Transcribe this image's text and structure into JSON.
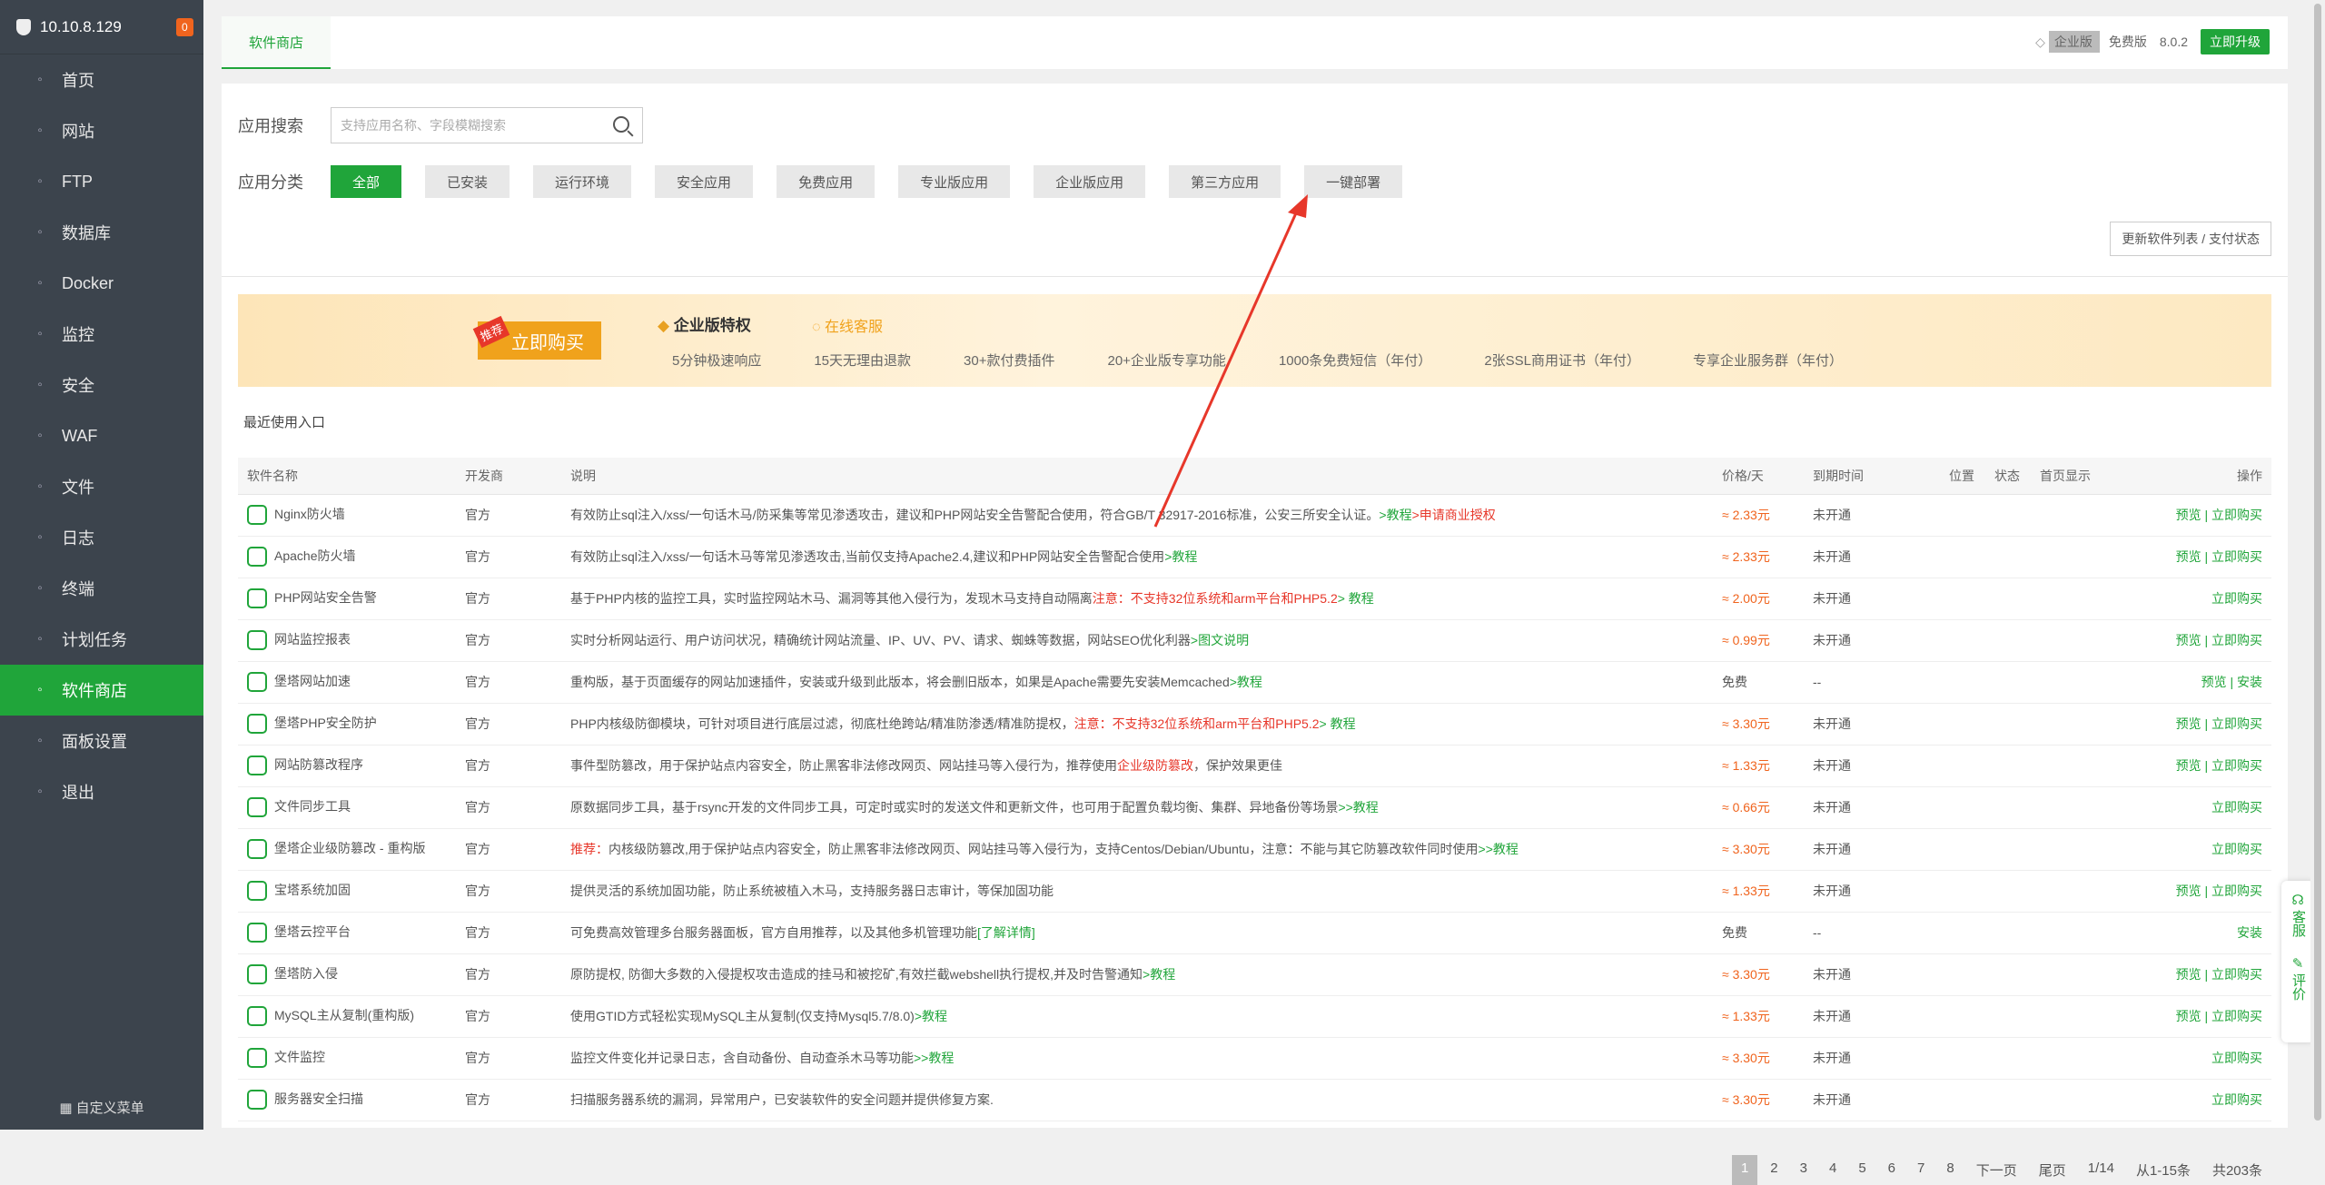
{
  "sidebar": {
    "ip": "10.10.8.129",
    "badge": "0",
    "items": [
      {
        "label": "首页",
        "icon": "home-icon"
      },
      {
        "label": "网站",
        "icon": "globe-icon"
      },
      {
        "label": "FTP",
        "icon": "ftp-icon"
      },
      {
        "label": "数据库",
        "icon": "database-icon"
      },
      {
        "label": "Docker",
        "icon": "docker-icon"
      },
      {
        "label": "监控",
        "icon": "monitor-icon"
      },
      {
        "label": "安全",
        "icon": "shield-icon"
      },
      {
        "label": "WAF",
        "icon": "waf-icon"
      },
      {
        "label": "文件",
        "icon": "folder-icon"
      },
      {
        "label": "日志",
        "icon": "log-icon"
      },
      {
        "label": "终端",
        "icon": "terminal-icon"
      },
      {
        "label": "计划任务",
        "icon": "clock-icon"
      },
      {
        "label": "软件商店",
        "icon": "store-icon"
      },
      {
        "label": "面板设置",
        "icon": "gear-icon"
      },
      {
        "label": "退出",
        "icon": "logout-icon"
      }
    ],
    "custom_menu": "自定义菜单"
  },
  "header": {
    "tab": "软件商店",
    "edition": "企业版",
    "free": "免费版",
    "version": "8.0.2",
    "upgrade": "立即升级"
  },
  "search": {
    "label": "应用搜索",
    "placeholder": "支持应用名称、字段模糊搜索"
  },
  "category": {
    "label": "应用分类",
    "items": [
      "全部",
      "已安装",
      "运行环境",
      "安全应用",
      "免费应用",
      "专业版应用",
      "企业版应用",
      "第三方应用",
      "一键部署"
    ],
    "refresh": "更新软件列表 / 支付状态"
  },
  "banner": {
    "recommend": "推荐",
    "buy": "立即购买",
    "title": "企业版特权",
    "service": "在线客服",
    "features": [
      "5分钟极速响应",
      "15天无理由退款",
      "30+款付费插件",
      "20+企业版专享功能",
      "1000条免费短信（年付）",
      "2张SSL商用证书（年付）",
      "专享企业服务群（年付）"
    ]
  },
  "recent": "最近使用入口",
  "table": {
    "headers": [
      "软件名称",
      "开发商",
      "说明",
      "价格/天",
      "到期时间",
      "位置",
      "状态",
      "首页显示",
      "操作"
    ],
    "rows": [
      {
        "name": "Nginx防火墙",
        "dev": "官方",
        "desc": "有效防止sql注入/xss/一句话木马/防采集等常见渗透攻击，建议和PHP网站安全告警配合使用，符合GB/T 32917-2016标准，公安三所安全认证。",
        "link": ">教程",
        "link2": ">申请商业授权",
        "price": "≈ 2.33元",
        "expire": "未开通",
        "ops": "预览 | 立即购买"
      },
      {
        "name": "Apache防火墙",
        "dev": "官方",
        "desc": "有效防止sql注入/xss/一句话木马等常见渗透攻击,当前仅支持Apache2.4,建议和PHP网站安全告警配合使用",
        "link": ">教程",
        "link2": "",
        "price": "≈ 2.33元",
        "expire": "未开通",
        "ops": "预览 | 立即购买"
      },
      {
        "name": "PHP网站安全告警",
        "dev": "官方",
        "desc": "基于PHP内核的监控工具，实时监控网站木马、漏洞等其他入侵行为，发现木马支持自动隔离",
        "warn": "注意：不支持32位系统和arm平台和PHP5.2",
        "link": "> 教程",
        "price": "≈ 2.00元",
        "expire": "未开通",
        "ops": "立即购买"
      },
      {
        "name": "网站监控报表",
        "dev": "官方",
        "desc": "实时分析网站运行、用户访问状况，精确统计网站流量、IP、UV、PV、请求、蜘蛛等数据，网站SEO优化利器",
        "link": ">图文说明",
        "price": "≈ 0.99元",
        "expire": "未开通",
        "ops": "预览 | 立即购买"
      },
      {
        "name": "堡塔网站加速",
        "dev": "官方",
        "desc": "重构版，基于页面缓存的网站加速插件，安装或升级到此版本，将会删旧版本，如果是Apache需要先安装Memcached",
        "link": ">教程",
        "price": "免费",
        "expire": "--",
        "ops": "预览 | 安装"
      },
      {
        "name": "堡塔PHP安全防护",
        "dev": "官方",
        "desc": "PHP内核级防御模块，可针对项目进行底层过滤，彻底杜绝跨站/精准防渗透/精准防提权，",
        "warn": "注意：不支持32位系统和arm平台和PHP5.2",
        "link": "> 教程",
        "price": "≈ 3.30元",
        "expire": "未开通",
        "ops": "预览 | 立即购买"
      },
      {
        "name": "网站防篡改程序",
        "dev": "官方",
        "desc": "事件型防篡改，用于保护站点内容安全，防止黑客非法修改网页、网站挂马等入侵行为，推荐使用",
        "warn": "企业级防篡改",
        "tail": "，保护效果更佳",
        "price": "≈ 1.33元",
        "expire": "未开通",
        "ops": "预览 | 立即购买"
      },
      {
        "name": "文件同步工具",
        "dev": "官方",
        "desc": "原数据同步工具，基于rsync开发的文件同步工具，可定时或实时的发送文件和更新文件，也可用于配置负载均衡、集群、异地备份等场景",
        "link": ">>教程",
        "price": "≈ 0.66元",
        "expire": "未开通",
        "ops": "立即购买"
      },
      {
        "name": "堡塔企业级防篡改 - 重构版",
        "dev": "官方",
        "pre": "推荐：",
        "desc": "内核级防篡改,用于保护站点内容安全，防止黑客非法修改网页、网站挂马等入侵行为，支持Centos/Debian/Ubuntu，注意：不能与其它防篡改软件同时使用",
        "link": ">>教程",
        "price": "≈ 3.30元",
        "expire": "未开通",
        "ops": "立即购买"
      },
      {
        "name": "宝塔系统加固",
        "dev": "官方",
        "desc": "提供灵活的系统加固功能，防止系统被植入木马，支持服务器日志审计，等保加固功能",
        "price": "≈ 1.33元",
        "expire": "未开通",
        "ops": "预览 | 立即购买"
      },
      {
        "name": "堡塔云控平台",
        "dev": "官方",
        "desc": "可免费高效管理多台服务器面板，官方自用推荐，以及其他多机管理功能",
        "link": "[了解详情]",
        "price": "免费",
        "expire": "--",
        "ops": "安装"
      },
      {
        "name": "堡塔防入侵",
        "dev": "官方",
        "desc": "原防提权, 防御大多数的入侵提权攻击造成的挂马和被挖矿,有效拦截webshell执行提权,并及时告警通知",
        "link": ">教程",
        "price": "≈ 3.30元",
        "expire": "未开通",
        "ops": "预览 | 立即购买"
      },
      {
        "name": "MySQL主从复制(重构版)",
        "dev": "官方",
        "desc": "使用GTID方式轻松实现MySQL主从复制(仅支持Mysql5.7/8.0)",
        "link": ">教程",
        "price": "≈ 1.33元",
        "expire": "未开通",
        "ops": "预览 | 立即购买"
      },
      {
        "name": "文件监控",
        "dev": "官方",
        "desc": "监控文件变化并记录日志，含自动备份、自动查杀木马等功能",
        "link": ">>教程",
        "price": "≈ 3.30元",
        "expire": "未开通",
        "ops": "立即购买"
      },
      {
        "name": "服务器安全扫描",
        "dev": "官方",
        "desc": "扫描服务器系统的漏洞，异常用户，已安装软件的安全问题并提供修复方案.",
        "price": "≈ 3.30元",
        "expire": "未开通",
        "ops": "立即购买"
      }
    ]
  },
  "pager": {
    "pages": [
      "1",
      "2",
      "3",
      "4",
      "5",
      "6",
      "7",
      "8"
    ],
    "next": "下一页",
    "last": "尾页",
    "pos": "1/14",
    "range": "从1-15条",
    "total": "共203条"
  },
  "side": {
    "service": "客服",
    "rate": "评价"
  },
  "colors": {
    "accent": "#20a53a",
    "sidebar": "#3c444d",
    "price": "#f0641e",
    "warn": "#e7372a"
  }
}
